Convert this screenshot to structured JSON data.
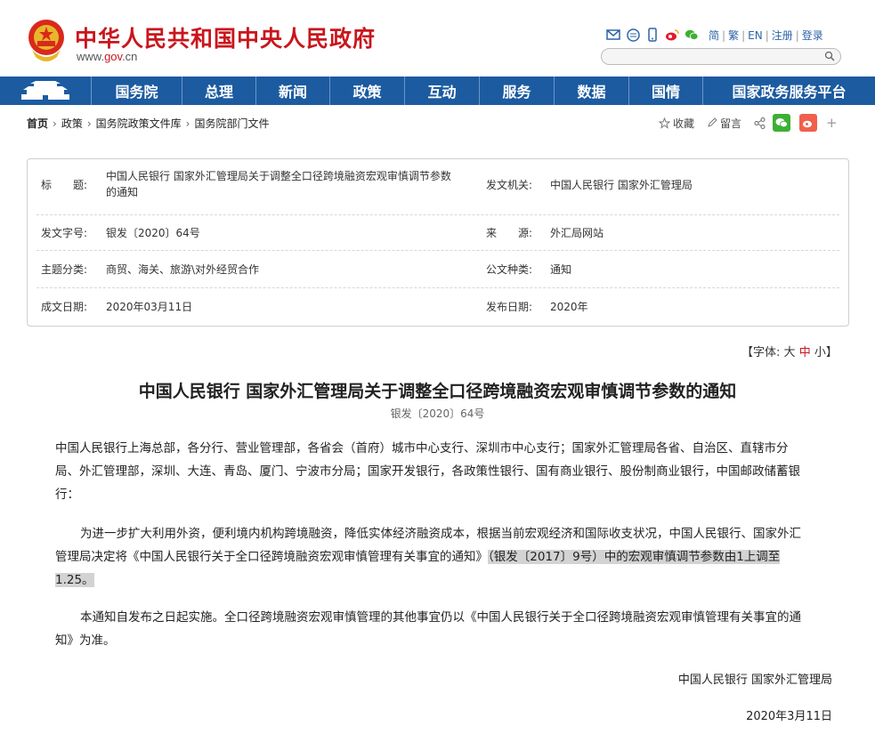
{
  "header": {
    "site_title": "中华人民共和国中央人民政府",
    "site_url_prefix": "www.",
    "site_url_gov": "gov",
    "site_url_suffix": ".cn",
    "lang_links": [
      "简",
      "繁",
      "EN",
      "注册",
      "登录"
    ]
  },
  "nav": {
    "items": [
      "国务院",
      "总理",
      "新闻",
      "政策",
      "互动",
      "服务",
      "数据",
      "国情",
      "国家政务服务平台"
    ]
  },
  "breadcrumb": {
    "home": "首页",
    "items": [
      "政策",
      "国务院政策文件库",
      "国务院部门文件"
    ]
  },
  "tools": {
    "favorite": "收藏",
    "comment": "留言"
  },
  "meta": {
    "title_label": "标　　题:",
    "title_value_line1": "中国人民银行 国家外汇管理局关于调整全口径跨境融资宏观审慎调节参数",
    "title_value_line2": "的通知",
    "issuer_label": "发文机关:",
    "issuer_value": "中国人民银行 国家外汇管理局",
    "docno_label": "发文字号:",
    "docno_value": "银发〔2020〕64号",
    "source_label": "来　　源:",
    "source_value": "外汇局网站",
    "topic_label": "主题分类:",
    "topic_value": "商贸、海关、旅游\\对外经贸合作",
    "type_label": "公文种类:",
    "type_value": "通知",
    "written_label": "成文日期:",
    "written_value": "2020年03月11日",
    "published_label": "发布日期:",
    "published_value": "2020年"
  },
  "font_switch": {
    "prefix": "【字体:",
    "large": "大",
    "medium": "中",
    "small": "小",
    "suffix": "】"
  },
  "article": {
    "title": "中国人民银行 国家外汇管理局关于调整全口径跨境融资宏观审慎调节参数的通知",
    "doc_no": "银发〔2020〕64号",
    "addressee_l1": "中国人民银行上海总部，各分行、营业管理部，各省会（首府）城市中心支行、深圳市中心支行；国家外汇管理局各省、自治区、直辖市分",
    "addressee_l2": "局、外汇管理部，深圳、大连、青岛、厦门、宁波市分局；国家开发银行，各政策性银行、国有商业银行、股份制商业银行，中国邮政储蓄银",
    "addressee_l3": "行：",
    "p1_l1": "为进一步扩大利用外资，便利境内机构跨境融资，降低实体经济融资成本，根据当前宏观经济和国际收支状况，中国人民银行、国家外汇",
    "p1_l2a": "管理局决定将《中国人民银行关于全口径跨境融资宏观审慎管理有关事宜的通知》",
    "p1_l2b": "（银发〔2017〕9号）中的宏观审慎调节参数由1上调至",
    "p1_l3": "1.25。",
    "p2_l1": "本通知自发布之日起实施。全口径跨境融资宏观审慎管理的其他事宜仍以《中国人民银行关于全口径跨境融资宏观审慎管理有关事宜的通",
    "p2_l2": "知》为准。",
    "sign_org": "中国人民银行 国家外汇管理局",
    "sign_date": "2020年3月11日"
  },
  "colors": {
    "brand_red": "#c9161d",
    "nav_blue": "#1c5ba0",
    "link_blue": "#2d63a8",
    "wechat_green": "#3cb034",
    "weibo_orange": "#f0604c"
  }
}
